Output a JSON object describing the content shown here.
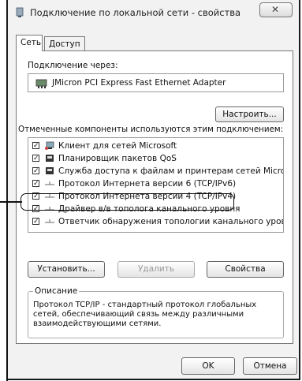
{
  "window": {
    "title": "Подключение по локальной сети - свойства",
    "close_glyph": "✕"
  },
  "tabs": [
    {
      "label": "Сеть",
      "active": true
    },
    {
      "label": "Доступ",
      "active": false
    }
  ],
  "connect_via_label": "Подключение через:",
  "adapter_name": "JMicron PCI Express Fast Ethernet Adapter",
  "configure_button": "Настроить...",
  "components_label": "Отмеченные компоненты используются этим подключением:",
  "components": [
    {
      "label": "Клиент для сетей Microsoft",
      "checked": true,
      "icon": "network-client-icon"
    },
    {
      "label": "Планировщик пакетов QoS",
      "checked": true,
      "icon": "network-service-icon"
    },
    {
      "label": "Служба доступа к файлам и принтерам сетей Micro...",
      "checked": true,
      "icon": "network-service-icon"
    },
    {
      "label": "Протокол Интернета версии 6 (TCP/IPv6)",
      "checked": true,
      "icon": "network-protocol-icon"
    },
    {
      "label": "Протокол Интернета версии 4 (TCP/IPv4)",
      "checked": true,
      "icon": "network-protocol-icon"
    },
    {
      "label": "Драйвер в/в тополога канального уровня",
      "checked": true,
      "icon": "network-protocol-icon"
    },
    {
      "label": "Ответчик обнаружения топологии канального уровня",
      "checked": true,
      "icon": "network-protocol-icon"
    }
  ],
  "buttons": {
    "install": "Установить...",
    "remove": "Удалить",
    "properties": "Свойства",
    "ok": "OK",
    "cancel": "Отмена"
  },
  "description": {
    "legend": "Описание",
    "text": "Протокол TCP/IP - стандартный протокол глобальных сетей, обеспечивающий связь между различными взаимодействующими сетями."
  }
}
